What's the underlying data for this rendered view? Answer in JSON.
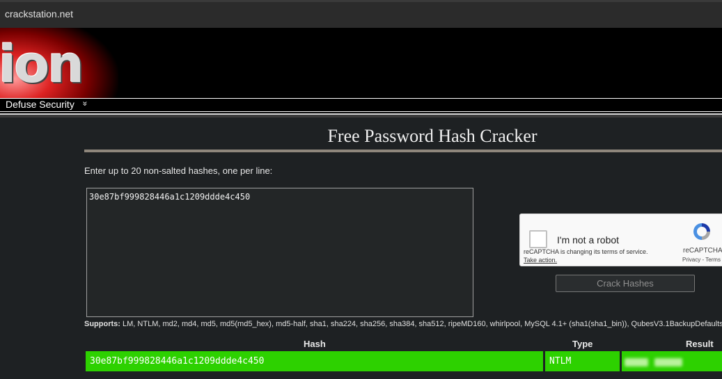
{
  "browser": {
    "url": "crackstation.net"
  },
  "banner": {
    "logo_text": "ion"
  },
  "nav": {
    "label": "Defuse Security",
    "chevron": "»"
  },
  "page": {
    "title": "Free Password Hash Cracker",
    "instructions": "Enter up to 20 non-salted hashes, one per line:",
    "hash_input_value": "30e87bf999828446a1c1209ddde4c450",
    "crack_button": "Crack Hashes",
    "supports_label": "Supports:",
    "supports_list": "LM, NTLM, md2, md4, md5, md5(md5_hex), md5-half, sha1, sha224, sha256, sha384, sha512, ripeMD160, whirlpool, MySQL 4.1+ (sha1(sha1_bin)), QubesV3.1BackupDefaults"
  },
  "captcha": {
    "label": "I'm not a robot",
    "notice": "reCAPTCHA is changing its terms of service.",
    "action": "Take action.",
    "brand": "reCAPTCHA",
    "links": "Privacy - Terms",
    "icon": "recaptcha-logo"
  },
  "results": {
    "headers": {
      "hash": "Hash",
      "type": "Type",
      "result": "Result"
    },
    "rows": [
      {
        "hash": "30e87bf999828446a1c1209ddde4c450",
        "type": "NTLM",
        "result": ""
      }
    ],
    "row_color": "#2dd100"
  }
}
